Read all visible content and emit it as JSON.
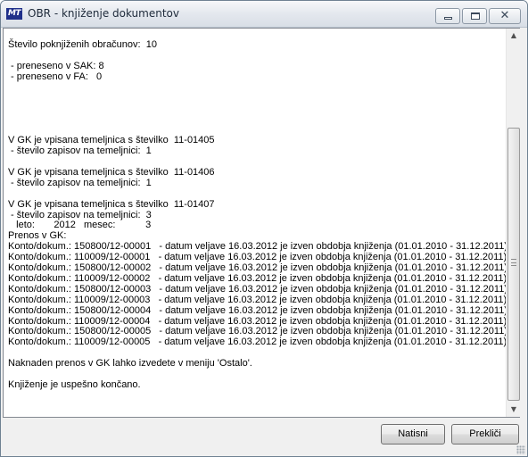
{
  "window": {
    "title": "OBR - knjiženje dokumentov",
    "app_icon_text": "MT",
    "min_glyph": "",
    "max_glyph": "",
    "close_glyph": "✕"
  },
  "output_text": "Število poknjiženih obračunov:  10\n\n - preneseno v SAK: 8\n - preneseno v FA:   0\n\n\n\n\n\nV GK je vpisana temeljnica s številko  11-01405\n - število zapisov na temeljnici:  1\n\nV GK je vpisana temeljnica s številko  11-01406\n - število zapisov na temeljnici:  1\n\nV GK je vpisana temeljnica s številko  11-01407\n - število zapisov na temeljnici:  3\n   leto:       2012   mesec:           3\nPrenos v GK:\nKonto/dokum.: 150800/12-00001   - datum veljave 16.03.2012 je izven obdobja knjiženja (01.01.2010 - 31.12.2011)\nKonto/dokum.: 110009/12-00001   - datum veljave 16.03.2012 je izven obdobja knjiženja (01.01.2010 - 31.12.2011)\nKonto/dokum.: 150800/12-00002   - datum veljave 16.03.2012 je izven obdobja knjiženja (01.01.2010 - 31.12.2011)\nKonto/dokum.: 110009/12-00002   - datum veljave 16.03.2012 je izven obdobja knjiženja (01.01.2010 - 31.12.2011)\nKonto/dokum.: 150800/12-00003   - datum veljave 16.03.2012 je izven obdobja knjiženja (01.01.2010 - 31.12.2011)\nKonto/dokum.: 110009/12-00003   - datum veljave 16.03.2012 je izven obdobja knjiženja (01.01.2010 - 31.12.2011)\nKonto/dokum.: 150800/12-00004   - datum veljave 16.03.2012 je izven obdobja knjiženja (01.01.2010 - 31.12.2011)\nKonto/dokum.: 110009/12-00004   - datum veljave 16.03.2012 je izven obdobja knjiženja (01.01.2010 - 31.12.2011)\nKonto/dokum.: 150800/12-00005   - datum veljave 16.03.2012 je izven obdobja knjiženja (01.01.2010 - 31.12.2011)\nKonto/dokum.: 110009/12-00005   - datum veljave 16.03.2012 je izven obdobja knjiženja (01.01.2010 - 31.12.2011)\n\nNaknaden prenos v GK lahko izvedete v meniju 'Ostalo'.\n\nKnjiženje je uspešno končano.",
  "scrollbar": {
    "up_arrow": "▲",
    "down_arrow": "▼"
  },
  "buttons": {
    "print_label": "Natisni",
    "cancel_label": "Prekliči"
  }
}
